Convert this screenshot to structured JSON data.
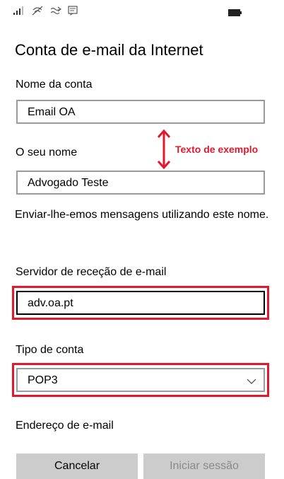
{
  "status_bar": {
    "icons": [
      "signal-icon",
      "wifi-icon",
      "sync-icon",
      "message-icon",
      "battery-icon"
    ]
  },
  "page": {
    "title": "Conta de e-mail da Internet"
  },
  "form": {
    "account_name": {
      "label": "Nome da conta",
      "value": "Email OA"
    },
    "your_name": {
      "label": "O seu nome",
      "value": "Advogado Teste",
      "helper": "Enviar-lhe-emos mensagens utilizando este nome."
    },
    "incoming_server": {
      "label": "Servidor de receção de e-mail",
      "value": "adv.oa.pt"
    },
    "account_type": {
      "label": "Tipo de conta",
      "selected": "POP3"
    },
    "email_address": {
      "label": "Endereço de e-mail"
    }
  },
  "annotation": {
    "text": "Texto de exemplo",
    "color": "#e3182d"
  },
  "buttons": {
    "cancel": "Cancelar",
    "sign_in": "Iniciar sessão"
  }
}
